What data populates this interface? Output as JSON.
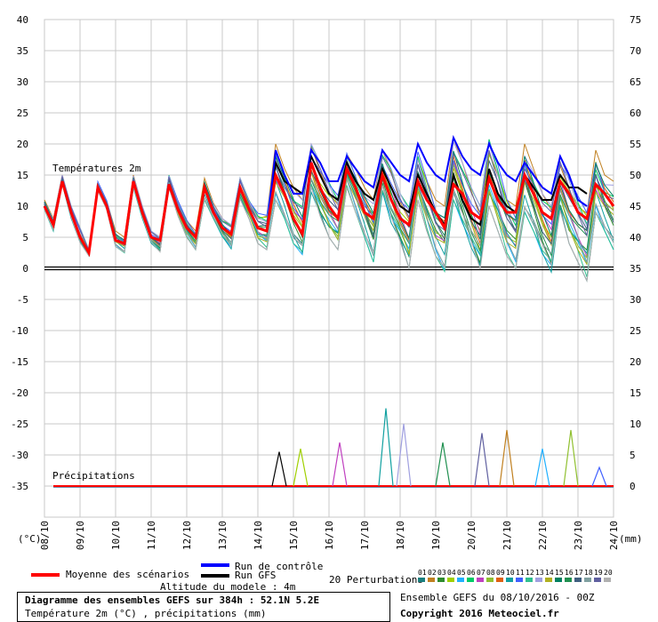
{
  "chart_data": {
    "type": "line",
    "dates": [
      "08/10",
      "09/10",
      "10/10",
      "11/10",
      "12/10",
      "13/10",
      "14/10",
      "15/10",
      "16/10",
      "17/10",
      "18/10",
      "19/10",
      "20/10",
      "21/10",
      "22/10",
      "23/10",
      "24/10"
    ],
    "left_axis": {
      "unit": "(°C)",
      "ylim": [
        -40,
        40
      ],
      "ticks": [
        40,
        35,
        30,
        25,
        20,
        15,
        10,
        5,
        0,
        -5,
        -10,
        -15,
        -20,
        -25,
        -30,
        -35
      ]
    },
    "right_axis": {
      "unit": "(mm)",
      "ylim": [
        -5,
        75
      ],
      "ticks": [
        75,
        70,
        65,
        60,
        55,
        50,
        45,
        40,
        35,
        30,
        25,
        20,
        15,
        10,
        5,
        0
      ]
    },
    "temperature": {
      "label": "Températures 2m",
      "x_step_hours": 6,
      "mean": [
        10,
        7,
        14,
        9,
        5,
        2.5,
        13,
        10,
        4.5,
        4,
        14,
        9,
        5,
        4.5,
        13.5,
        9.5,
        6.5,
        5,
        13,
        9,
        6.5,
        5.5,
        13,
        9.5,
        6.5,
        6,
        15,
        12,
        8,
        5.5,
        17,
        13,
        10,
        8,
        16,
        13,
        9,
        8,
        15,
        11,
        8,
        7,
        14,
        11,
        9,
        6.5,
        13.5,
        12,
        9,
        8,
        14.5,
        11,
        9,
        9,
        15,
        12,
        9,
        8,
        14,
        12,
        9,
        8,
        13.5,
        12,
        10
      ],
      "control": [
        10,
        7,
        14,
        9,
        5,
        2.5,
        13,
        10,
        4.5,
        4,
        14,
        9,
        5,
        4.5,
        13.5,
        9.5,
        6.5,
        5,
        13,
        9,
        6.5,
        5.5,
        13,
        9.5,
        6.5,
        6,
        19,
        15,
        12,
        12,
        19,
        17,
        14,
        14,
        18,
        16,
        14,
        13,
        19,
        17,
        15,
        14,
        20,
        17,
        15,
        14,
        21,
        18,
        16,
        15,
        20,
        17,
        15,
        14,
        17,
        15,
        13,
        12,
        18,
        15,
        11,
        10
      ],
      "gfs": [
        10,
        7,
        14,
        9,
        5,
        2.5,
        13,
        10,
        4.5,
        4,
        14,
        9,
        5,
        4.5,
        13.5,
        9.5,
        6.5,
        5,
        13,
        9,
        6.5,
        5.5,
        13,
        9.5,
        6.5,
        6,
        17,
        14,
        13,
        12,
        18,
        15,
        12,
        11,
        17,
        14,
        12,
        11,
        16,
        13,
        10,
        9,
        15,
        12,
        9,
        7,
        15,
        11,
        8,
        7,
        16,
        12,
        10,
        9,
        15,
        13,
        11,
        11,
        15,
        13,
        13,
        12
      ],
      "perturbation_range": [
        [
          9.5,
          11
        ],
        [
          6,
          8
        ],
        [
          13.5,
          15
        ],
        [
          8,
          10
        ],
        [
          4,
          6.5
        ],
        [
          2,
          3
        ],
        [
          12.5,
          14
        ],
        [
          9.5,
          11
        ],
        [
          3.5,
          6
        ],
        [
          2.5,
          5
        ],
        [
          13,
          15
        ],
        [
          8,
          10
        ],
        [
          4,
          6
        ],
        [
          2.5,
          5
        ],
        [
          13,
          15
        ],
        [
          8.5,
          11
        ],
        [
          5,
          8
        ],
        [
          3,
          6
        ],
        [
          11,
          14.5
        ],
        [
          8,
          10.5
        ],
        [
          5,
          8
        ],
        [
          3,
          7
        ],
        [
          11,
          14.5
        ],
        [
          8,
          11
        ],
        [
          4,
          9
        ],
        [
          3,
          9
        ],
        [
          11,
          20
        ],
        [
          8,
          16
        ],
        [
          4,
          13
        ],
        [
          2,
          11
        ],
        [
          12,
          20
        ],
        [
          8,
          17
        ],
        [
          5,
          14
        ],
        [
          3,
          12
        ],
        [
          13,
          19
        ],
        [
          9,
          16
        ],
        [
          5,
          13
        ],
        [
          1,
          11
        ],
        [
          12,
          19
        ],
        [
          7,
          16
        ],
        [
          4,
          12
        ],
        [
          0,
          10
        ],
        [
          11,
          19
        ],
        [
          6,
          15
        ],
        [
          2,
          11
        ],
        [
          -0.5,
          10
        ],
        [
          11,
          21
        ],
        [
          7,
          17
        ],
        [
          3,
          13
        ],
        [
          -0.5,
          10
        ],
        [
          10,
          21
        ],
        [
          6,
          17
        ],
        [
          2,
          12
        ],
        [
          0,
          10
        ],
        [
          9,
          20
        ],
        [
          6,
          16
        ],
        [
          2,
          12
        ],
        [
          -1,
          10
        ],
        [
          9,
          18
        ],
        [
          4,
          15
        ],
        [
          1,
          12
        ],
        [
          -2,
          10
        ],
        [
          9,
          19
        ],
        [
          6,
          15
        ],
        [
          3,
          14
        ]
      ]
    },
    "precipitation": {
      "label": "Précipitations",
      "unit": "mm",
      "spikes": [
        {
          "date_index": 6.6,
          "value": 5.5,
          "series": "gfs"
        },
        {
          "date_index": 7.2,
          "value": 6,
          "series": "perturbation"
        },
        {
          "date_index": 8.3,
          "value": 7,
          "series": "perturbation"
        },
        {
          "date_index": 9.6,
          "value": 12.5,
          "series": "perturbation"
        },
        {
          "date_index": 10.1,
          "value": 10,
          "series": "perturbation"
        },
        {
          "date_index": 11.2,
          "value": 7,
          "series": "perturbation"
        },
        {
          "date_index": 12.3,
          "value": 8.5,
          "series": "perturbation"
        },
        {
          "date_index": 13.0,
          "value": 9,
          "series": "perturbation"
        },
        {
          "date_index": 14.0,
          "value": 6,
          "series": "perturbation"
        },
        {
          "date_index": 14.8,
          "value": 9,
          "series": "perturbation"
        },
        {
          "date_index": 15.6,
          "value": 3,
          "series": "perturbation"
        }
      ]
    }
  },
  "legend": {
    "mean": "Moyenne des scénarios",
    "control": "Run de contrôle",
    "gfs": "Run GFS",
    "perturbations": "20 Perturbations",
    "altitude": "Altitude du modele : 4m",
    "colors": {
      "mean": "#ff0000",
      "control": "#0000ff",
      "gfs": "#000000"
    }
  },
  "perturbation_ids": [
    "01",
    "02",
    "03",
    "04",
    "05",
    "06",
    "07",
    "08",
    "09",
    "10",
    "11",
    "12",
    "13",
    "14",
    "15",
    "16",
    "17",
    "18",
    "19",
    "20"
  ],
  "perturbation_colors": [
    "#1a7f7f",
    "#c08020",
    "#2e8b2e",
    "#a0d000",
    "#20b0ff",
    "#00cc66",
    "#c040c0",
    "#90c030",
    "#e06010",
    "#10a0a0",
    "#4060ff",
    "#30c090",
    "#a0a0e0",
    "#b0b020",
    "#008060",
    "#209050",
    "#406080",
    "#80a0a0",
    "#6060a0",
    "#b0b0b0"
  ],
  "footer": {
    "title": "Diagramme des ensembles GEFS sur 384h : 52.1N 5.2E",
    "subtitle": "Température 2m (°C) , précipitations (mm)",
    "run": "Ensemble GEFS du 08/10/2016 - 00Z",
    "copyright": "Copyright 2016 Meteociel.fr"
  }
}
